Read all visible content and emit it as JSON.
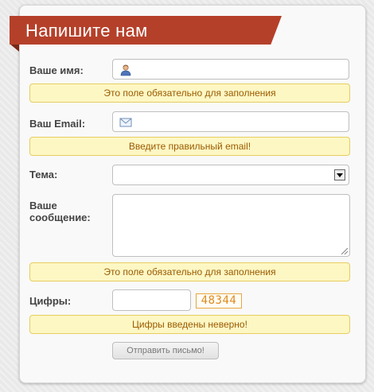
{
  "header": {
    "title": "Напишите нам"
  },
  "form": {
    "name": {
      "label": "Ваше имя:",
      "value": "",
      "error": "Это поле обязательно для заполнения"
    },
    "email": {
      "label": "Ваш Email:",
      "value": "",
      "error": "Введите правильный email!"
    },
    "subject": {
      "label": "Тема:",
      "selected": ""
    },
    "message": {
      "label_line1": "Ваше",
      "label_line2": "сообщение:",
      "value": "",
      "error": "Это поле обязательно для заполнения"
    },
    "captcha": {
      "label": "Цифры:",
      "value": "",
      "code": "48344",
      "error": "Цифры введены неверно!"
    },
    "submit_label": "Отправить письмо!"
  },
  "colors": {
    "ribbon": "#b5402a",
    "error_bg": "#fdf7c4",
    "error_text": "#9a5b00",
    "captcha": "#e08a1e"
  },
  "icons": {
    "name_field": "user-icon",
    "email_field": "envelope-icon"
  }
}
